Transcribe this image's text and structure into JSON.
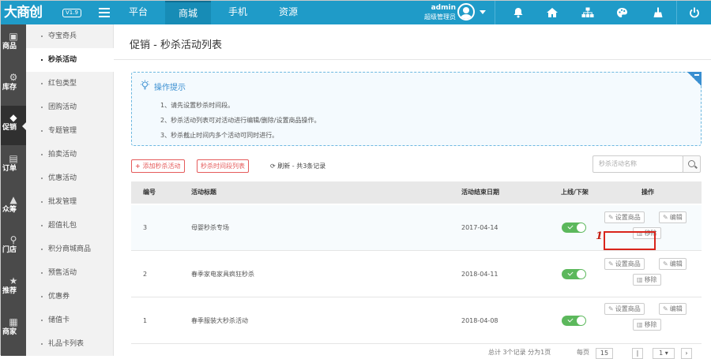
{
  "header": {
    "logo": "大商创",
    "version": "V1.9",
    "nav_tabs": [
      {
        "label": "平台"
      },
      {
        "label": "商城"
      },
      {
        "label": "手机"
      },
      {
        "label": "资源"
      }
    ],
    "user_name": "admin",
    "user_role": "超级管理员",
    "right_icons": [
      "bell-icon",
      "home-icon",
      "sitemap-icon",
      "palette-icon",
      "broom-icon",
      "power-icon"
    ]
  },
  "iconbar": {
    "items": [
      {
        "label": "商品",
        "icon": "box-icon"
      },
      {
        "label": "库存",
        "icon": "gears-icon"
      },
      {
        "label": "促销",
        "icon": "tag-icon"
      },
      {
        "label": "订单",
        "icon": "clipboard-icon"
      },
      {
        "label": "众筹",
        "icon": "crowdfunding-icon"
      },
      {
        "label": "门店",
        "icon": "location-pin-icon"
      },
      {
        "label": "推荐",
        "icon": "star-icon"
      },
      {
        "label": "商家",
        "icon": "store-icon"
      }
    ]
  },
  "submenu": {
    "items": [
      {
        "label": "夺宝奇兵"
      },
      {
        "label": "秒杀活动"
      },
      {
        "label": "红包类型"
      },
      {
        "label": "团购活动"
      },
      {
        "label": "专题管理"
      },
      {
        "label": "拍卖活动"
      },
      {
        "label": "优惠活动"
      },
      {
        "label": "批发管理"
      },
      {
        "label": "超值礼包"
      },
      {
        "label": "积分商城商品"
      },
      {
        "label": "预售活动"
      },
      {
        "label": "优惠券"
      },
      {
        "label": "储值卡"
      },
      {
        "label": "礼品卡列表"
      }
    ]
  },
  "page": {
    "title": "促销 - 秒杀活动列表",
    "tips_title": "操作提示",
    "tips": [
      "1、请先设置秒杀时间段。",
      "2、秒杀活动列表可对活动进行编辑/删除/设置商品操作。",
      "3、秒杀截止时间内多个活动可同时进行。"
    ],
    "add_button": "添加秒杀活动",
    "timeslot_button": "秒杀时间段列表",
    "refresh_text": "刷新 - 共3条记录",
    "search_placeholder": "秒杀活动名称"
  },
  "table": {
    "headers": [
      "编号",
      "活动标题",
      "活动结束日期",
      "上线/下架",
      "操作"
    ],
    "rows": [
      {
        "id": "3",
        "title": "母婴秒杀专场",
        "end_date": "2017-04-14",
        "online": true
      },
      {
        "id": "2",
        "title": "春季家电家具疯狂秒杀",
        "end_date": "2018-04-11",
        "online": true
      },
      {
        "id": "1",
        "title": "春季服装大秒杀活动",
        "end_date": "2018-04-08",
        "online": true
      }
    ],
    "actions": {
      "set_goods": "设置商品",
      "edit": "编辑",
      "remove": "移除"
    }
  },
  "annotation": {
    "number": "1",
    "color": "#d9241b"
  },
  "footer": {
    "total_text": "总计 3个记录 分为1页",
    "per_page_label": "每页",
    "per_page_value": "15",
    "page_value": "1"
  },
  "colors": {
    "brand": "#1f9bc8",
    "danger": "#e55b5b",
    "success": "#5cb85c",
    "tip": "#3a8fd1"
  }
}
